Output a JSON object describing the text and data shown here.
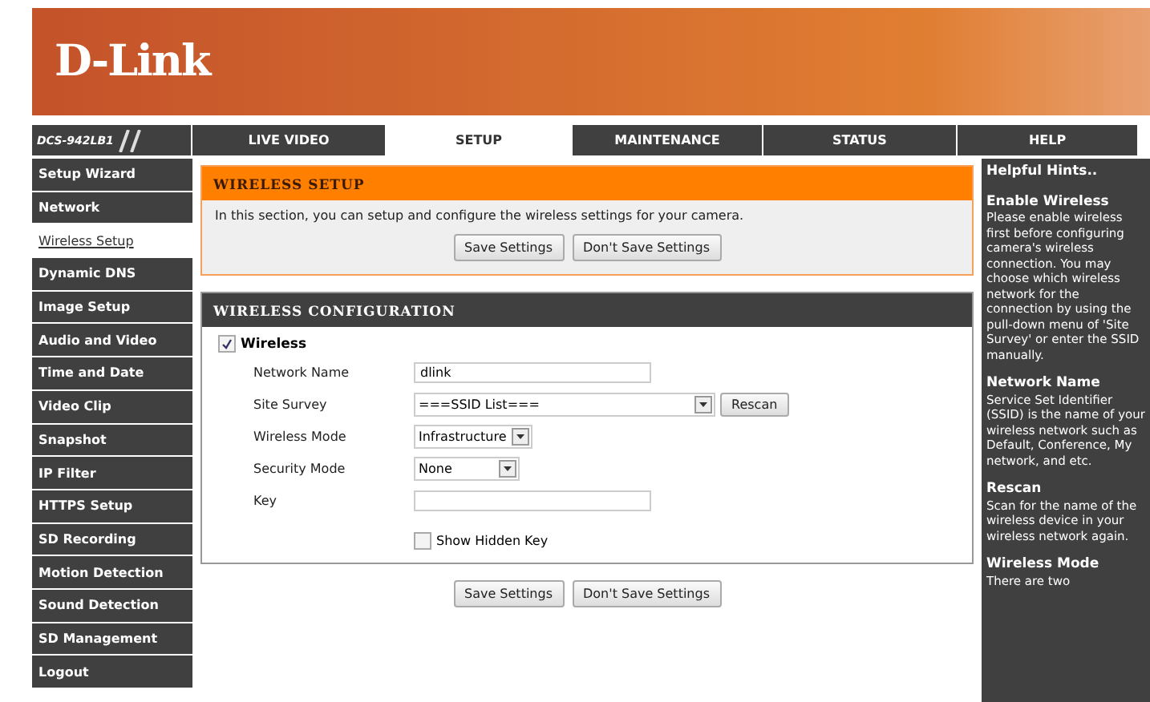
{
  "header": {
    "logo": "D-Link"
  },
  "model": "DCS-942LB1",
  "tabs": [
    {
      "label": "LIVE VIDEO",
      "selected": false
    },
    {
      "label": "SETUP",
      "selected": true
    },
    {
      "label": "MAINTENANCE",
      "selected": false
    },
    {
      "label": "STATUS",
      "selected": false
    },
    {
      "label": "HELP",
      "selected": false
    }
  ],
  "sidebar": {
    "items": [
      {
        "label": "Setup Wizard",
        "selected": false
      },
      {
        "label": "Network",
        "selected": false
      },
      {
        "label": "Wireless Setup",
        "selected": true
      },
      {
        "label": "Dynamic DNS",
        "selected": false
      },
      {
        "label": "Image Setup",
        "selected": false
      },
      {
        "label": "Audio and Video",
        "selected": false
      },
      {
        "label": "Time and Date",
        "selected": false
      },
      {
        "label": "Video Clip",
        "selected": false
      },
      {
        "label": "Snapshot",
        "selected": false
      },
      {
        "label": "IP Filter",
        "selected": false
      },
      {
        "label": "HTTPS Setup",
        "selected": false
      },
      {
        "label": "SD Recording",
        "selected": false
      },
      {
        "label": "Motion Detection",
        "selected": false
      },
      {
        "label": "Sound Detection",
        "selected": false
      },
      {
        "label": "SD Management",
        "selected": false
      },
      {
        "label": "Logout",
        "selected": false
      }
    ]
  },
  "setup": {
    "title": "WIRELESS SETUP",
    "text": "In this section, you can setup and configure the wireless settings for your camera.",
    "buttons": [
      "Save Settings",
      "Don't Save Settings"
    ]
  },
  "config": {
    "title": "WIRELESS CONFIGURATION",
    "wireless": {
      "label": "Wireless",
      "checked": true
    },
    "fields": [
      {
        "kind": "text",
        "label": "Network Name",
        "value": "dlink"
      },
      {
        "kind": "survey",
        "label": "Site Survey",
        "value": "===SSID List===",
        "button": "Rescan"
      },
      {
        "kind": "select",
        "label": "Wireless Mode",
        "value": "Infrastructure"
      },
      {
        "kind": "select",
        "label": "Security Mode",
        "value": "None"
      },
      {
        "kind": "text",
        "label": "Key"
      }
    ],
    "show_hidden_key": {
      "label": "Show Hidden Key",
      "checked": false
    }
  },
  "bottom_buttons": [
    "Save Settings",
    "Don't Save Settings"
  ],
  "help": {
    "title": "Helpful Hints..",
    "sections": [
      {
        "heading": "Enable Wireless",
        "text": "Please enable wireless first before configuring camera's wireless connection. You may choose which wireless network for the connection by using the pull-down menu of 'Site Survey' or enter the SSID manually."
      },
      {
        "heading": "Network Name",
        "text": "Service Set Identifier (SSID) is the name of your wireless network such as Default, Conference, My network, and etc."
      },
      {
        "heading": "Rescan",
        "text": "Scan for the name of the wireless device in your wireless network again."
      },
      {
        "heading": "Wireless Mode",
        "text": "There are two"
      }
    ]
  }
}
